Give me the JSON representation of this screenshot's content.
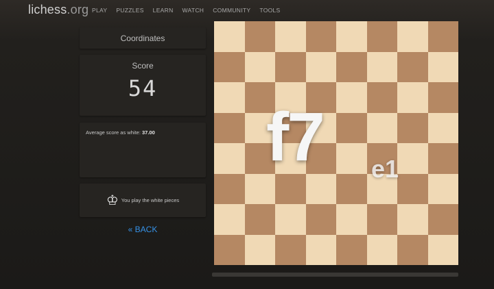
{
  "header": {
    "logo_main": "lichess",
    "logo_tld": ".org",
    "nav": [
      "PLAY",
      "PUZZLES",
      "LEARN",
      "WATCH",
      "COMMUNITY",
      "TOOLS"
    ]
  },
  "sidebar": {
    "title": "Coordinates",
    "score_label": "Score",
    "score_value": "54",
    "avg_label": "Average score as white:",
    "avg_value": "37.00",
    "color_icon": "white-king-icon",
    "color_text": "You play the white pieces",
    "back_label": "« BACK"
  },
  "board": {
    "current_coord": "f7",
    "next_coord": "e1",
    "light_color": "#f0d9b5",
    "dark_color": "#b58863"
  },
  "colors": {
    "accent_link": "#3692e7"
  }
}
